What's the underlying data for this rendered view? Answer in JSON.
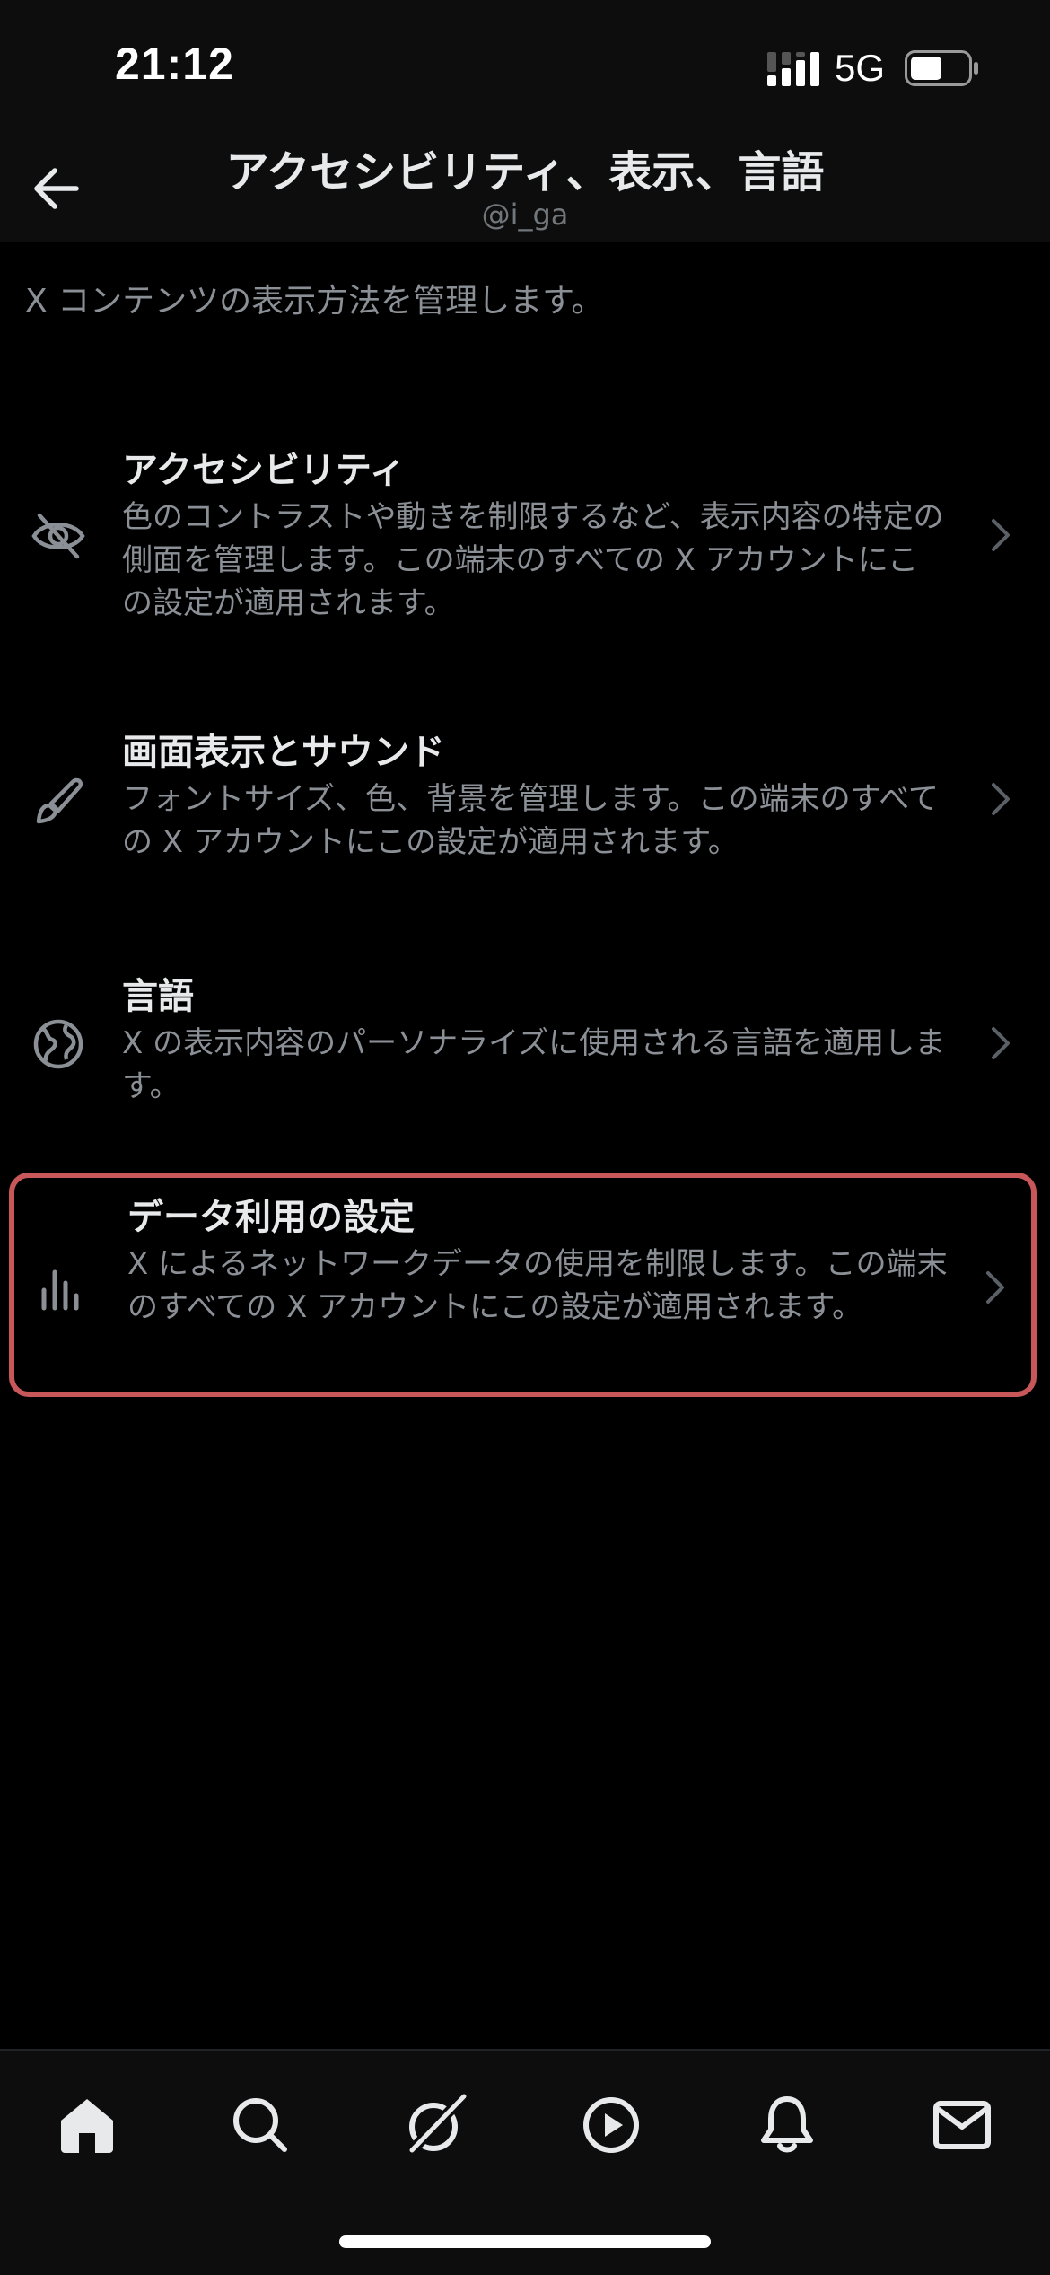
{
  "status_bar": {
    "time": "21:12",
    "network": "5G",
    "signal_icon": "cellular-signal-icon",
    "battery_icon": "battery-icon",
    "battery_level": 0.55
  },
  "header": {
    "back_icon": "arrow-left-icon",
    "title": "アクセシビリティ、表示、言語",
    "subtitle": "@i_ga"
  },
  "description": "X コンテンツの表示方法を管理します。",
  "items": [
    {
      "icon": "eye-slash-icon",
      "title": "アクセシビリティ",
      "description": "色のコントラストや動きを制限するなど、表示内容の特定の側面を管理します。この端末のすべての X アカウントにこの設定が適用されます。"
    },
    {
      "icon": "brush-icon",
      "title": "画面表示とサウンド",
      "description": "フォントサイズ、色、背景を管理します。この端末のすべての X アカウントにこの設定が適用されます。"
    },
    {
      "icon": "globe-icon",
      "title": "言語",
      "description": "X の表示内容のパーソナライズに使用される言語を適用します。"
    },
    {
      "icon": "bar-chart-icon",
      "title": "データ利用の設定",
      "description": "X によるネットワークデータの使用を制限します。この端末のすべての X アカウントにこの設定が適用されます。"
    }
  ],
  "tab_bar": {
    "tabs": [
      "home-icon",
      "search-icon",
      "grok-icon",
      "video-icon",
      "bell-icon",
      "mail-icon"
    ],
    "accent": "#ffffff",
    "inactive": "#e7e9ea"
  },
  "colors": {
    "background": "#000000",
    "text_primary": "#e7e9ea",
    "text_secondary": "#8b9096",
    "highlight_border": "#c8575a"
  }
}
